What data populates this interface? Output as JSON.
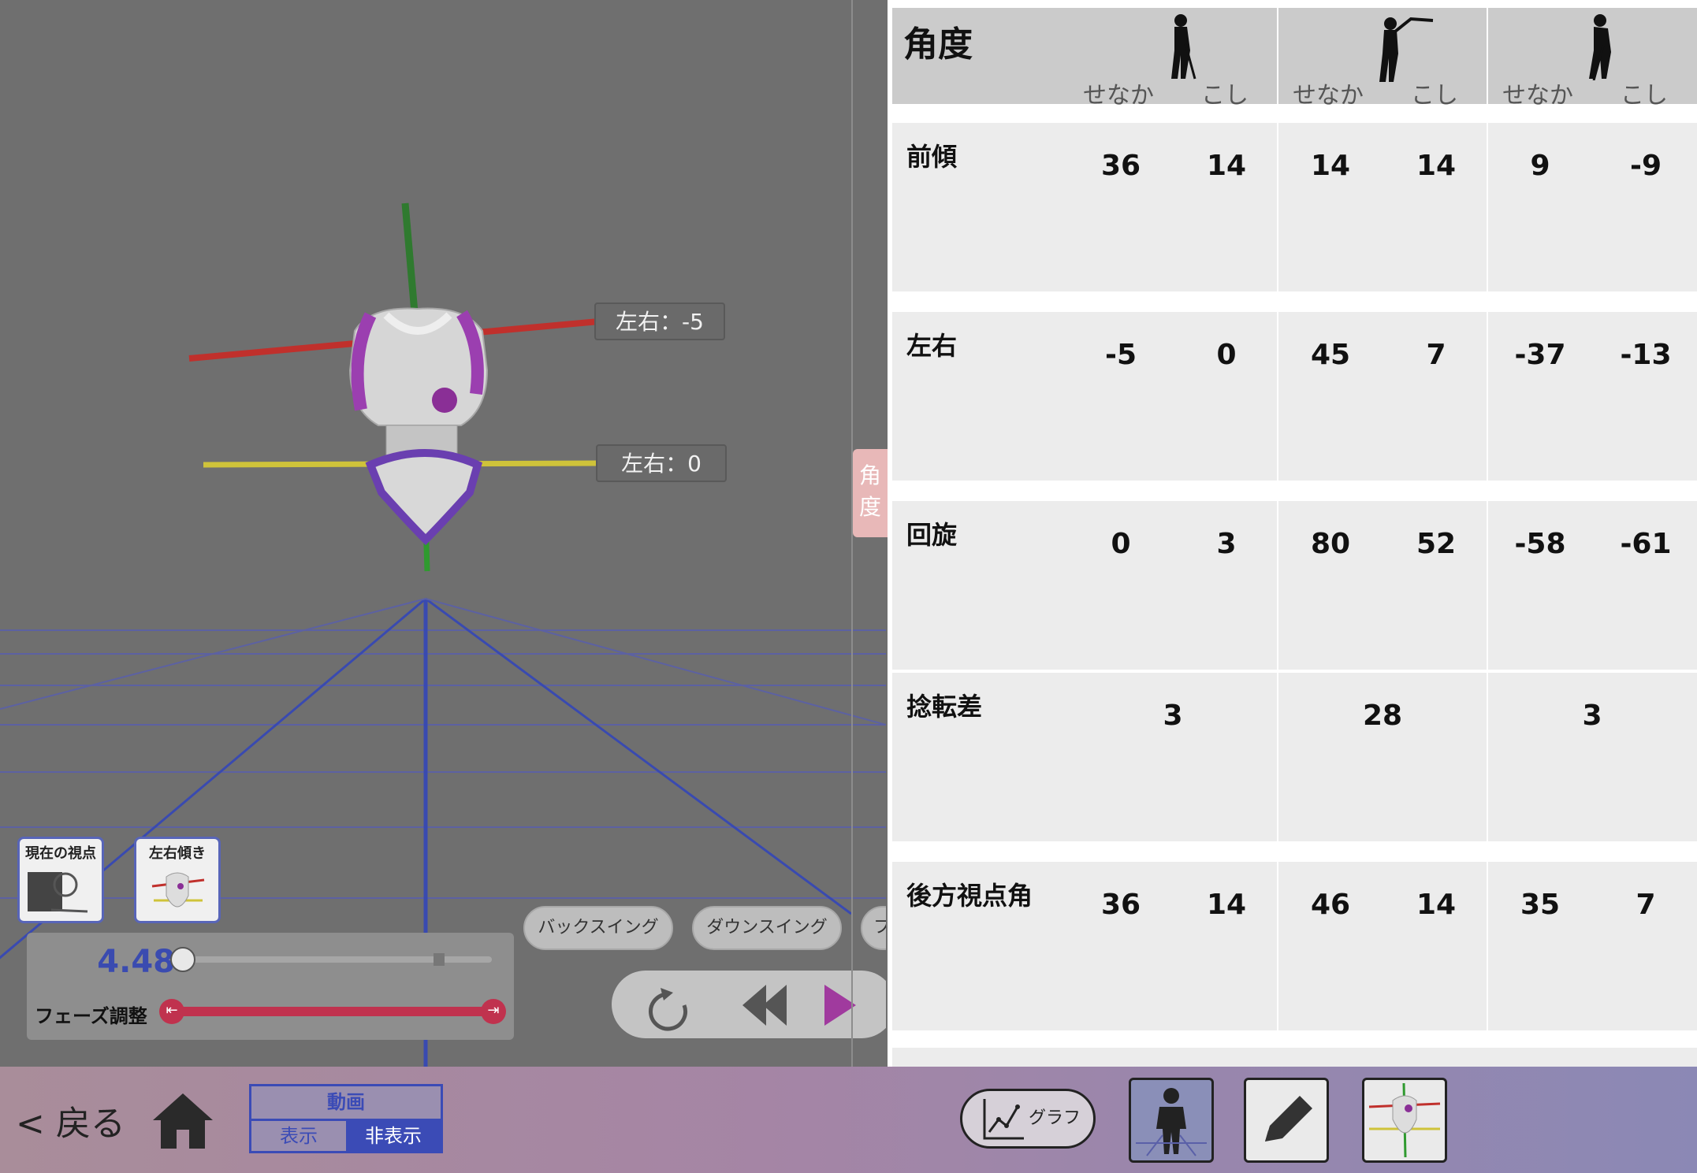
{
  "viewport": {
    "axis_labels": [
      "左右：-5",
      "左右：0"
    ],
    "view_buttons": [
      "現在の視点",
      "左右傾き"
    ],
    "time_value": "4.48",
    "phase_label": "フェーズ調整",
    "phase_buttons": [
      "バックスイング",
      "ダウンスイング",
      "フ"
    ],
    "side_tab": [
      "角",
      "度"
    ]
  },
  "table": {
    "title": "角度",
    "subheaders": [
      "せなか",
      "こし"
    ],
    "rows": [
      {
        "label": "前傾",
        "values": [
          "36",
          "14",
          "14",
          "14",
          "9",
          "-9"
        ]
      },
      {
        "label": "左右",
        "values": [
          "-5",
          "0",
          "45",
          "7",
          "-37",
          "-13"
        ]
      },
      {
        "label": "回旋",
        "values": [
          "0",
          "3",
          "80",
          "52",
          "-58",
          "-61"
        ]
      },
      {
        "label": "捻転差",
        "values": [
          "3",
          "28",
          "3"
        ]
      },
      {
        "label": "後方視点角",
        "values": [
          "36",
          "14",
          "46",
          "14",
          "35",
          "7"
        ]
      }
    ]
  },
  "bottom": {
    "back": "< 戻る",
    "video_title": "動画",
    "show": "表示",
    "hide": "非表示",
    "graph": "グラフ"
  },
  "colors": {
    "accent": "#3b4bb6",
    "purple": "#9b3fb0",
    "play": "#a03a9e"
  }
}
